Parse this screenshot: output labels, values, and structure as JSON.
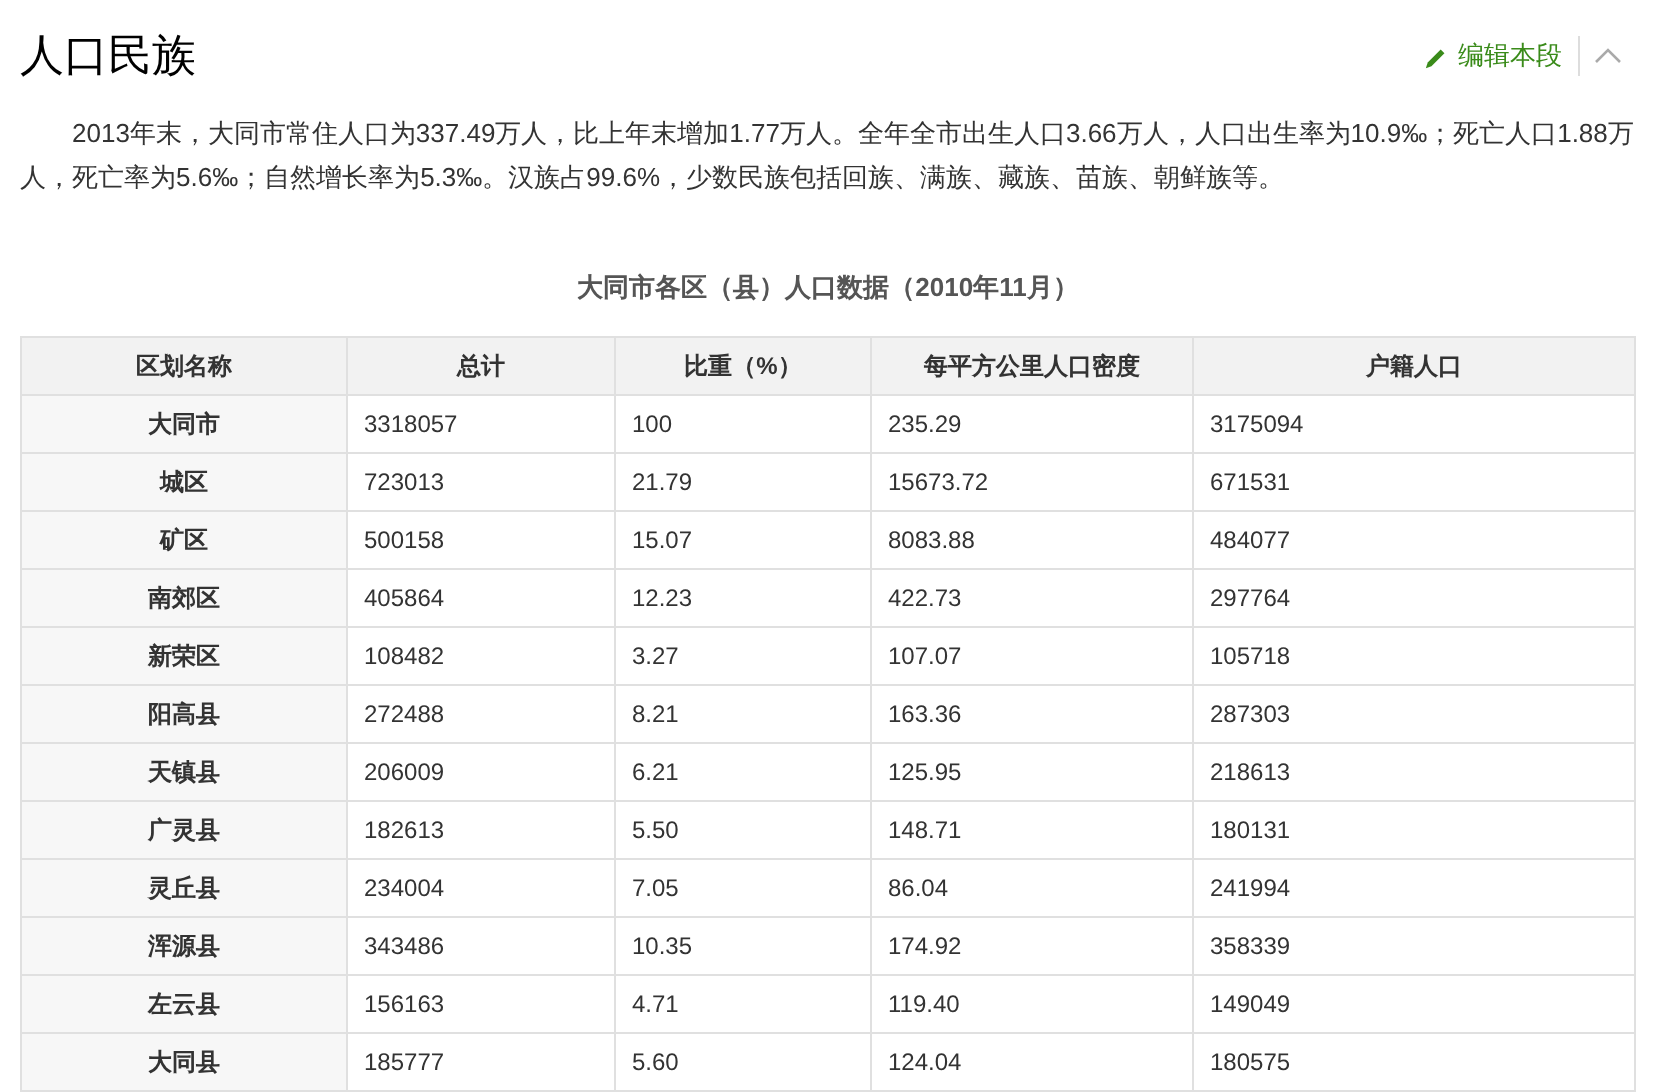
{
  "section": {
    "title": "人口民族",
    "edit_link": "编辑本段"
  },
  "paragraph": "2013年末，大同市常住人口为337.49万人，比上年末增加1.77万人。全年全市出生人口3.66万人，人口出生率为10.9‰；死亡人口1.88万人，死亡率为5.6‰；自然增长率为5.3‰。汉族占99.6%，少数民族包括回族、满族、藏族、苗族、朝鲜族等。",
  "table": {
    "caption": "大同市各区（县）人口数据（2010年11月）",
    "columns": [
      "区划名称",
      "总计",
      "比重（%）",
      "每平方公里人口密度",
      "户籍人口"
    ],
    "rows": [
      [
        "大同市",
        "3318057",
        "100",
        "235.29",
        "3175094"
      ],
      [
        "城区",
        "723013",
        "21.79",
        "15673.72",
        "671531"
      ],
      [
        "矿区",
        "500158",
        "15.07",
        "8083.88",
        "484077"
      ],
      [
        "南郊区",
        "405864",
        "12.23",
        "422.73",
        "297764"
      ],
      [
        "新荣区",
        "108482",
        "3.27",
        "107.07",
        "105718"
      ],
      [
        "阳高县",
        "272488",
        "8.21",
        "163.36",
        "287303"
      ],
      [
        "天镇县",
        "206009",
        "6.21",
        "125.95",
        "218613"
      ],
      [
        "广灵县",
        "182613",
        "5.50",
        "148.71",
        "180131"
      ],
      [
        "灵丘县",
        "234004",
        "7.05",
        "86.04",
        "241994"
      ],
      [
        "浑源县",
        "343486",
        "10.35",
        "174.92",
        "358339"
      ],
      [
        "左云县",
        "156163",
        "4.71",
        "119.40",
        "149049"
      ],
      [
        "大同县",
        "185777",
        "5.60",
        "124.04",
        "180575"
      ]
    ]
  }
}
